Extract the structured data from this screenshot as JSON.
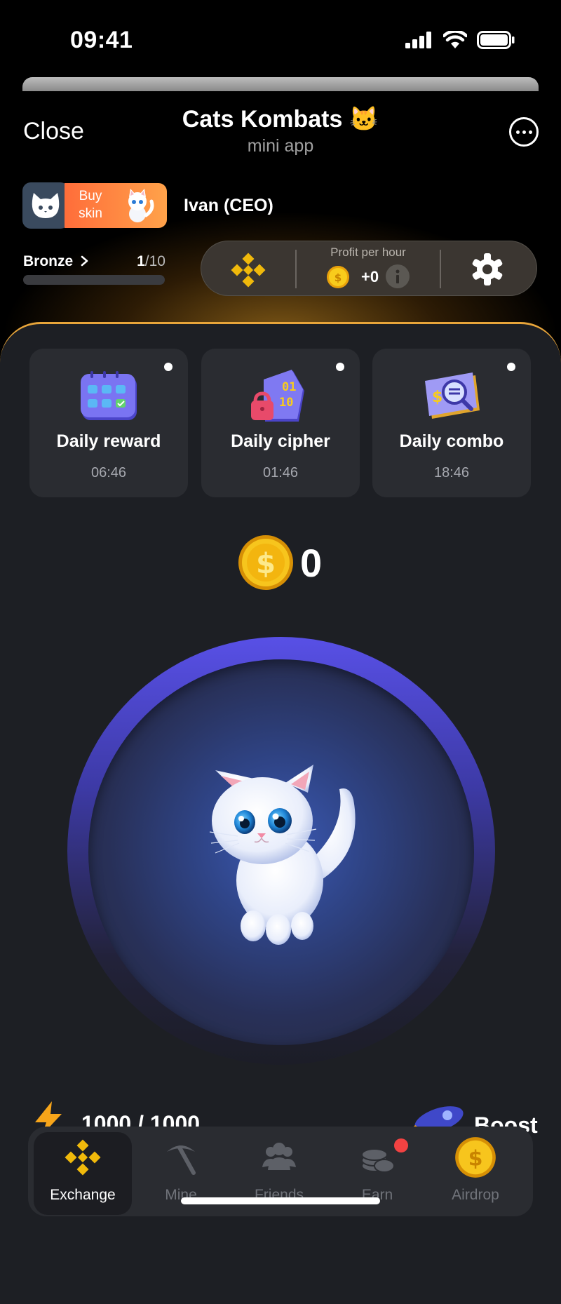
{
  "status": {
    "time": "09:41"
  },
  "header": {
    "close_label": "Close",
    "title": "Cats Kombats 🐱",
    "subtitle": "mini app",
    "more_icon": "more-horizontal-icon"
  },
  "user": {
    "buy_skin_label": "Buy skin",
    "name": "Ivan (CEO)"
  },
  "level": {
    "name": "Bronze",
    "current": "1",
    "total": "/10",
    "progress": 0.0
  },
  "profit": {
    "label": "Profit per hour",
    "value": "+0"
  },
  "daily": [
    {
      "title": "Daily reward",
      "time": "06:46"
    },
    {
      "title": "Daily cipher",
      "time": "01:46"
    },
    {
      "title": "Daily combo",
      "time": "18:46"
    }
  ],
  "balance": "0",
  "energy": {
    "value": "1000 / 1000"
  },
  "boost_label": "Boost",
  "nav": [
    {
      "label": "Exchange",
      "active": true
    },
    {
      "label": "Mine"
    },
    {
      "label": "Friends"
    },
    {
      "label": "Earn",
      "badge": true
    },
    {
      "label": "Airdrop"
    }
  ],
  "colors": {
    "accent": "#f0b90b",
    "orange": "#ff7a3a",
    "panel": "#1d1f24",
    "card": "#2a2c31",
    "glow": "#e8a53a",
    "ring": "#5850e6"
  }
}
